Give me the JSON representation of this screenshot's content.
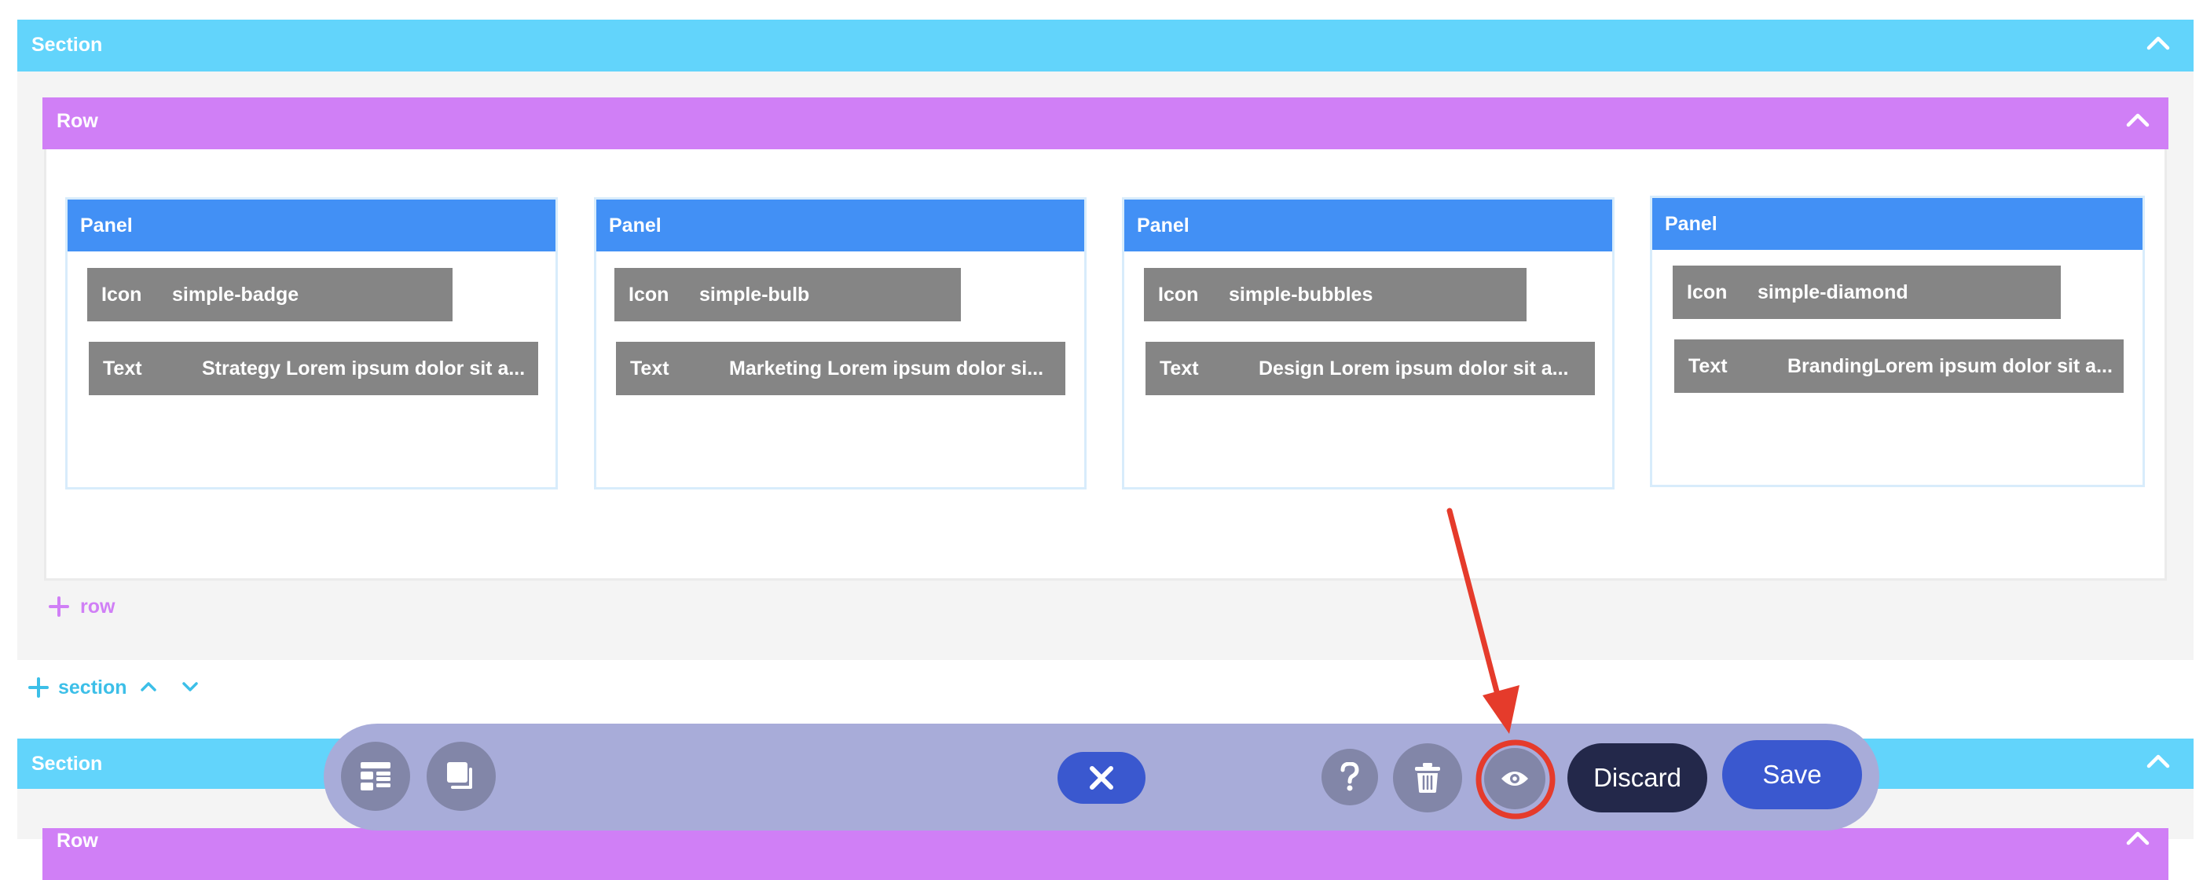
{
  "colors": {
    "section": "#62d4fb",
    "row": "#d07ff6",
    "panel": "#4290f5",
    "chip": "#858585",
    "toolbar": "#a8acd9",
    "save": "#3a58cf",
    "discard": "#23284a",
    "annotation": "#e53b2b"
  },
  "section1": {
    "title": "Section"
  },
  "row1": {
    "title": "Row"
  },
  "panels": [
    {
      "title": "Panel",
      "icon_key": "Icon",
      "icon_value": "simple-badge",
      "text_key": "Text",
      "text_value": "Strategy Lorem ipsum dolor sit a..."
    },
    {
      "title": "Panel",
      "icon_key": "Icon",
      "icon_value": "simple-bulb",
      "text_key": "Text",
      "text_value": "Marketing  Lorem ipsum dolor si..."
    },
    {
      "title": "Panel",
      "icon_key": "Icon",
      "icon_value": "simple-bubbles",
      "text_key": "Text",
      "text_value": "Design  Lorem ipsum dolor sit a..."
    },
    {
      "title": "Panel",
      "icon_key": "Icon",
      "icon_value": "simple-diamond",
      "text_key": "Text",
      "text_value": "BrandingLorem ipsum dolor sit a..."
    }
  ],
  "add_row": {
    "label": "row"
  },
  "add_section": {
    "label": "section"
  },
  "section2": {
    "title": "Section"
  },
  "row2": {
    "title": "Row"
  },
  "toolbar": {
    "discard_label": "Discard",
    "save_label": "Save",
    "icons": [
      "layout-icon",
      "copy-icon",
      "close-icon",
      "help-icon",
      "trash-icon",
      "eye-icon"
    ]
  }
}
